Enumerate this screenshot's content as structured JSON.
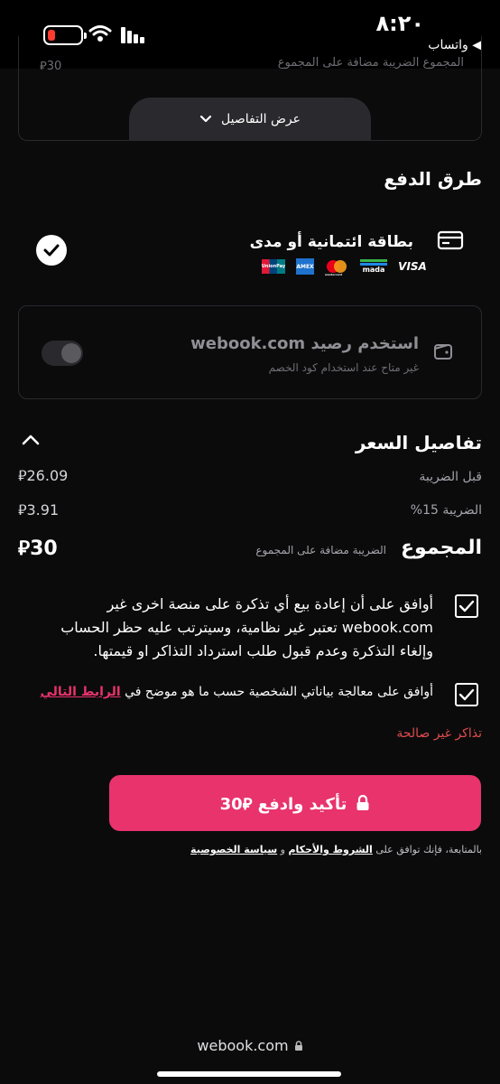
{
  "status_bar": {
    "time": "٨:٢٠",
    "back_app": "◀ واتساب"
  },
  "top_card": {
    "peek_text": "المجموع الضريبة مضافة على المجموع",
    "peek_amount": "⃁30",
    "details_button": "عرض التفاصيل"
  },
  "payment_methods": {
    "title": "طرق الدفع",
    "card": {
      "label": "بطاقة ائتمانية أو مدى",
      "brands": [
        "VISA",
        "mada",
        "mastercard",
        "AMEX",
        "UnionPay"
      ]
    },
    "wallet": {
      "label": "استخدم رصيد webook.com",
      "sub": "غير متاح عند استخدام كود الخصم"
    }
  },
  "price_details": {
    "title": "تفاصيل السعر",
    "before_tax_label": "قبل الضريبة",
    "before_tax_amount": "⃁26.09",
    "tax_label": "الضريبة 15%",
    "tax_amount": "⃁3.91",
    "total_label": "المجموع",
    "total_note": "الضريبة مضافة على المجموع",
    "total_amount": "⃁30"
  },
  "agreements": {
    "resale": "أوافق على أن إعادة بيع أي تذكرة على منصة اخرى غير webook.com تعتبر غير نظامية، وسيترتب عليه حظر الحساب وإلغاء التذكرة وعدم قبول طلب استرداد التذاكر او قيمتها.",
    "privacy_text": "أوافق على معالجة بياناتي الشخصية حسب ما هو موضح في",
    "privacy_link": "الرابط التالي"
  },
  "invalid_text": "تذاكر غير صالحة",
  "pay_button": "تأكيد وادفع ⃁30",
  "terms": {
    "prefix": "بالمتابعة، فإنك توافق على",
    "terms_link": "الشروط والأحكام",
    "and": "و",
    "privacy_link": "سياسة الخصوصية"
  },
  "browser": {
    "url": "webook.com"
  },
  "colors": {
    "accent": "#e8336d",
    "error": "#e04b4b",
    "background": "#0b0b0c"
  }
}
